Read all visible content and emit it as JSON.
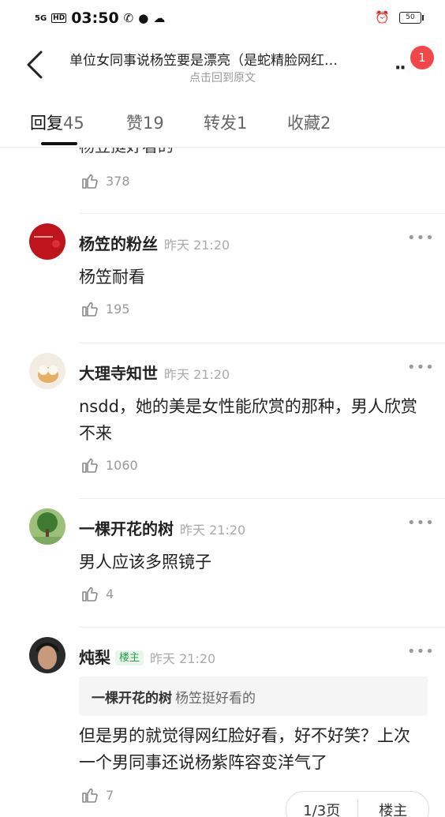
{
  "status_bar": {
    "network": "5G",
    "hd": "HD",
    "time": "03:50",
    "battery": "50"
  },
  "nav": {
    "title": "单位女同事说杨笠要是漂亮（是蛇精脸网红…",
    "subtitle": "点击回到原文",
    "badge_count": "1"
  },
  "tabs": [
    {
      "label": "回复",
      "count": "45"
    },
    {
      "label": "赞",
      "count": "19"
    },
    {
      "label": "转发",
      "count": "1"
    },
    {
      "label": "收藏",
      "count": "2"
    }
  ],
  "partial_comment": {
    "text": "杨笠挺好看的",
    "likes": "378"
  },
  "comments": [
    {
      "name": "杨笠的粉丝",
      "time": "昨天 21:20",
      "text": "杨笠耐看",
      "likes": "195"
    },
    {
      "name": "大理寺知世",
      "time": "昨天 21:20",
      "text": "nsdd，她的美是女性能欣赏的那种，男人欣赏不来",
      "likes": "1060"
    },
    {
      "name": "一棵开花的树",
      "time": "昨天 21:20",
      "text": "男人应该多照镜子",
      "likes": "4"
    },
    {
      "name": "炖梨",
      "host_tag": "楼主",
      "time": "昨天 21:20",
      "quote": {
        "name": "一棵开花的树",
        "text": "杨笠挺好看的"
      },
      "text": "但是男的就觉得网红脸好看，好不好笑？上次一个男同事还说杨紫阵容变洋气了",
      "likes": "7"
    }
  ],
  "pager": {
    "page": "1/3页",
    "host": "楼主"
  },
  "colors": {
    "badge": "#f04848",
    "host_tag": "#2e9e4c"
  }
}
